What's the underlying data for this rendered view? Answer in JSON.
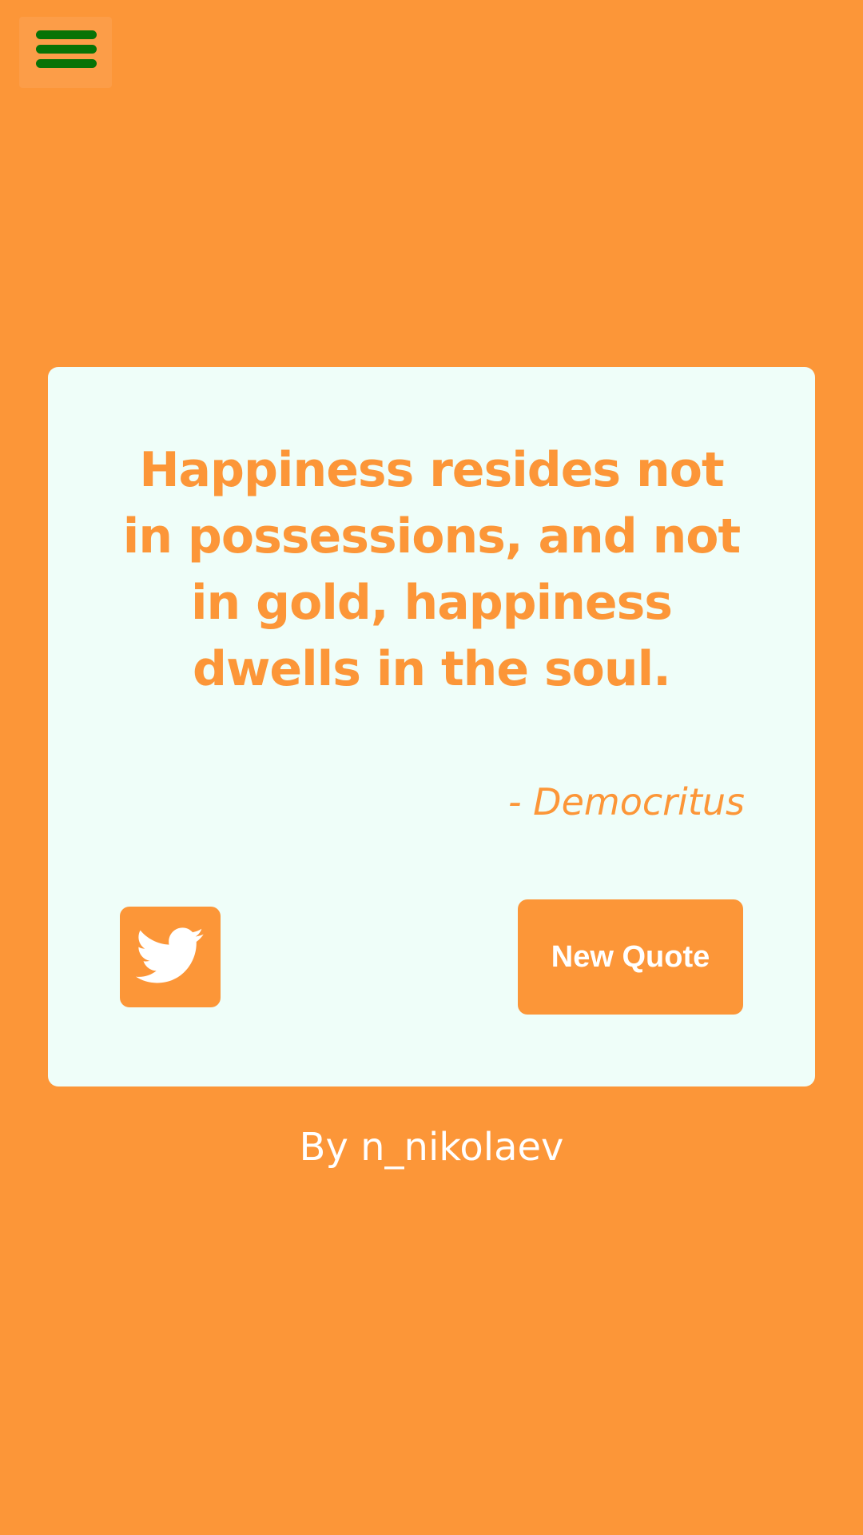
{
  "menu": {
    "icon": "hamburger-menu-icon",
    "bar_color": "#077306"
  },
  "quote": {
    "text": "Happiness resides not in possessions, and not in gold, happiness dwells in the soul.",
    "author": "- Democritus"
  },
  "actions": {
    "tweet_icon": "twitter-bird-icon",
    "new_quote_label": "New Quote"
  },
  "footer": {
    "credit": "By n_nikolaev"
  },
  "colors": {
    "background": "#fc9638",
    "card": "#effef9",
    "accent": "#fc9638",
    "menu_bars": "#077306",
    "button_text": "#ffffff"
  }
}
